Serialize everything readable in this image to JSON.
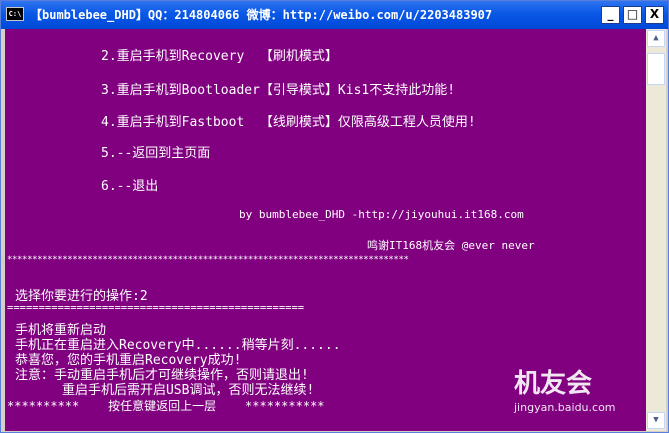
{
  "window": {
    "icon_label": "C:\\",
    "title": "【bumblebee_DHD】QQ：214804066 微博：http://weibo.com/u/2203483907",
    "minimize_glyph": "_",
    "maximize_glyph": "□",
    "close_glyph": "X"
  },
  "console": {
    "menu_items": [
      "2.重启手机到Recovery  【刷机模式】",
      "3.重启手机到Bootloader【引导模式】Kis1不支持此功能!",
      "4.重启手机到Fastboot  【线刷模式】仅限高级工程人员使用!",
      "5.--返回到主页面",
      "6.--退出"
    ],
    "credit_line": "by bumblebee_DHD -http://jiyouhui.it168.com",
    "thanks_line": "鸣谢IT168机友会 @ever never",
    "star_divider": "********************************************************************************",
    "prompt": "选择你要进行的操作:2",
    "equals_divider": "===============================================",
    "messages": [
      "手机将重新启动",
      "手机正在重启进入Recovery中......稍等片刻......",
      "恭喜您，您的手机重启Recovery成功!",
      "注意：手动重启手机后才可继续操作，否则请退出!",
      "      重启手机后需开启USB调试，否则无法继续!"
    ],
    "footer": "**********    按任意键返回上一层    ***********"
  },
  "scrollbar": {
    "up_glyph": "▲",
    "down_glyph": "▼"
  },
  "watermark": {
    "brand": "机友会",
    "url": "jingyan.baidu.com"
  }
}
